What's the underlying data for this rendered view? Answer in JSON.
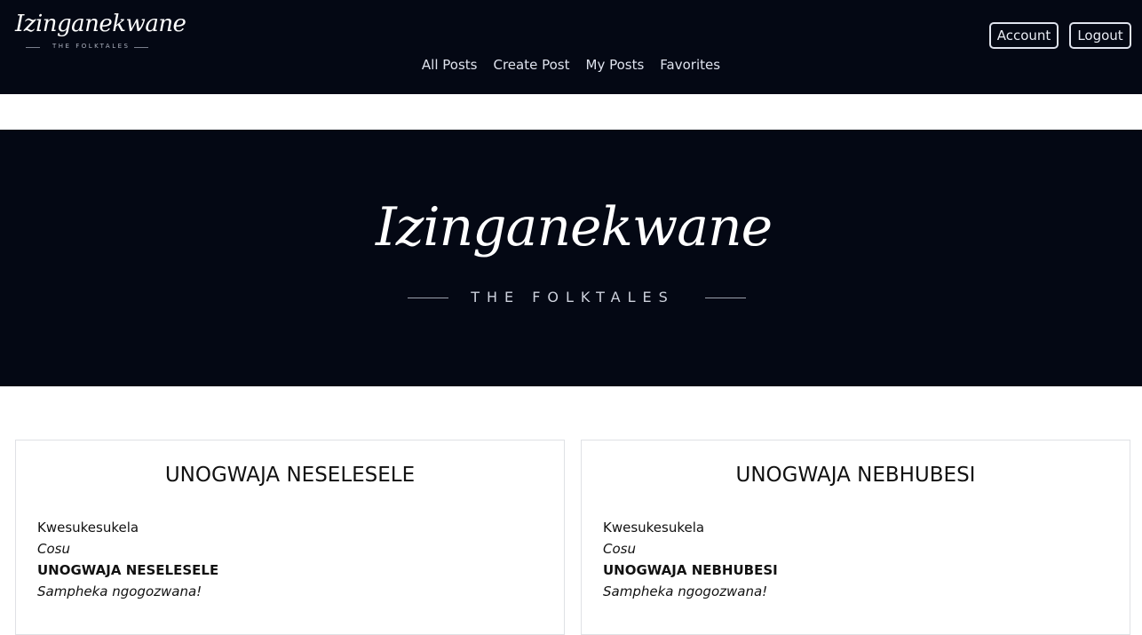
{
  "navbar": {
    "brand": {
      "script": "Izinganekwane",
      "subtitle": "THE FOLKTALES"
    },
    "links": [
      "All Posts",
      "Create Post",
      "My Posts",
      "Favorites"
    ],
    "account_label": "Account",
    "logout_label": "Logout"
  },
  "hero": {
    "script": "Izinganekwane",
    "subtitle": "THE FOLKTALES"
  },
  "posts": [
    {
      "title": "UNOGWAJA NESELESELE",
      "lines": [
        "Kwesukesukela",
        "Cosu",
        "UNOGWAJA NESELESELE",
        "Sampheka ngogozwana!"
      ]
    },
    {
      "title": "UNOGWAJA NEBHUBESI",
      "lines": [
        "Kwesukesukela",
        "Cosu",
        "UNOGWAJA NEBHUBESI",
        "Sampheka ngogozwana!"
      ]
    }
  ],
  "colors": {
    "navy": "#040814",
    "white": "#ffffff"
  }
}
